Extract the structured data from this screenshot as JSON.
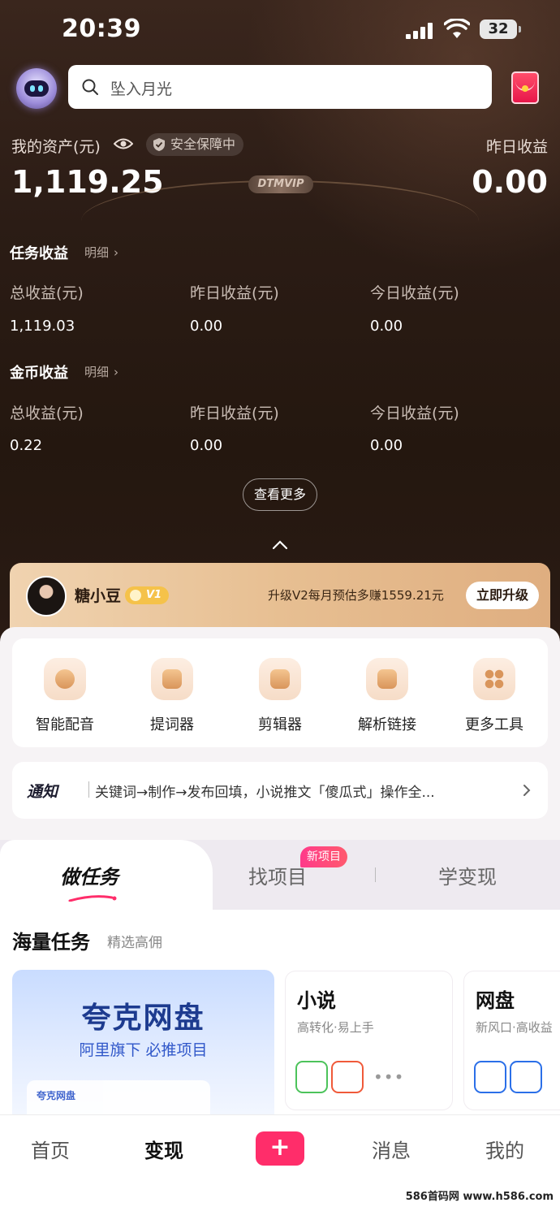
{
  "status_bar": {
    "time": "20:39",
    "battery": "32"
  },
  "search": {
    "placeholder": "坠入月光"
  },
  "assets": {
    "label": "我的资产(元)",
    "safety_badge": "安全保障中",
    "value": "1,119.25",
    "vip_badge": "DTMVIP",
    "yesterday_label": "昨日收益",
    "yesterday_value": "0.00"
  },
  "task_income": {
    "title": "任务收益",
    "detail": "明细",
    "stats": [
      {
        "label": "总收益(元)",
        "value": "1,119.03"
      },
      {
        "label": "昨日收益(元)",
        "value": "0.00"
      },
      {
        "label": "今日收益(元)",
        "value": "0.00"
      }
    ]
  },
  "coin_income": {
    "title": "金币收益",
    "detail": "明细",
    "stats": [
      {
        "label": "总收益(元)",
        "value": "0.22"
      },
      {
        "label": "昨日收益(元)",
        "value": "0.00"
      },
      {
        "label": "今日收益(元)",
        "value": "0.00"
      }
    ]
  },
  "see_more": "查看更多",
  "member": {
    "name": "糖小豆",
    "level": "V1",
    "upgrade_text": "升级V2每月预估多赚1559.21元",
    "upgrade_button": "立即升级"
  },
  "tools": [
    {
      "label": "智能配音",
      "icon": "voice-icon"
    },
    {
      "label": "提词器",
      "icon": "teleprompter-icon"
    },
    {
      "label": "剪辑器",
      "icon": "editor-icon"
    },
    {
      "label": "解析链接",
      "icon": "link-parse-icon"
    },
    {
      "label": "更多工具",
      "icon": "grid-icon"
    }
  ],
  "notice": {
    "tag": "通知",
    "message": "关键词→制作→发布回填，小说推文「傻瓜式」操作全..."
  },
  "tabs": {
    "items": [
      "做任务",
      "找项目",
      "学变现"
    ],
    "new_badge": "新项目"
  },
  "section": {
    "title": "海量任务",
    "subtitle": "精选高佣"
  },
  "cards": {
    "main": {
      "title": "夸克网盘",
      "subtitle": "阿里旗下 必推项目",
      "mini_label": "夸克网盘"
    },
    "novel": {
      "title": "小说",
      "subtitle": "高转化·易上手"
    },
    "netdisk": {
      "title": "网盘",
      "subtitle": "新风口·高收益"
    }
  },
  "nav": {
    "items": [
      "首页",
      "变现",
      "消息",
      "我的"
    ],
    "plus": "+"
  },
  "watermark": "586首码网 www.h586.com",
  "colors": {
    "accent": "#ff2d6a",
    "dark_bg": "#2a1a12",
    "gold": "#e7bf92"
  }
}
